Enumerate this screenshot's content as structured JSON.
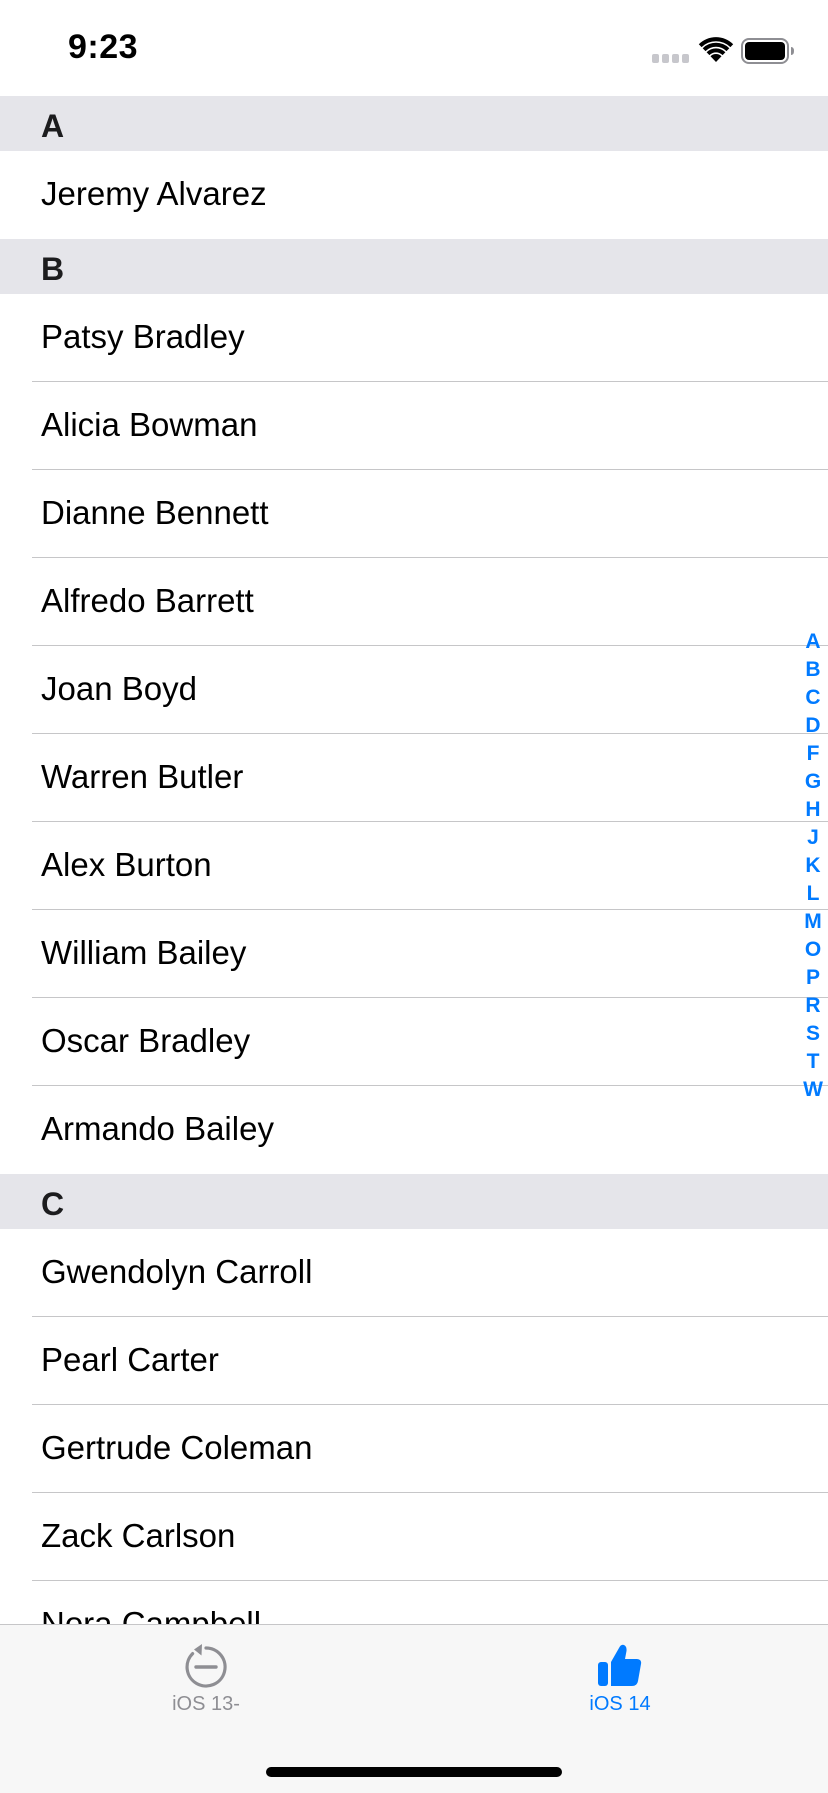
{
  "status_bar": {
    "time": "9:23"
  },
  "sections": [
    {
      "letter": "A",
      "rows": [
        "Jeremy Alvarez"
      ]
    },
    {
      "letter": "B",
      "rows": [
        "Patsy Bradley",
        "Alicia Bowman",
        "Dianne Bennett",
        "Alfredo Barrett",
        "Joan Boyd",
        "Warren Butler",
        "Alex Burton",
        "William Bailey",
        "Oscar Bradley",
        "Armando Bailey"
      ]
    },
    {
      "letter": "C",
      "rows": [
        "Gwendolyn Carroll",
        "Pearl Carter",
        "Gertrude Coleman",
        "Zack Carlson",
        "Nora Campbell"
      ]
    }
  ],
  "section_index": [
    "A",
    "B",
    "C",
    "D",
    "F",
    "G",
    "H",
    "J",
    "K",
    "L",
    "M",
    "O",
    "P",
    "R",
    "S",
    "T",
    "W"
  ],
  "tab_bar": {
    "tabs": [
      {
        "label": "iOS 13-",
        "icon": "rewind-circle-icon",
        "selected": false
      },
      {
        "label": "iOS 14",
        "icon": "thumbs-up-icon",
        "selected": true
      }
    ]
  },
  "colors": {
    "accent": "#007aff",
    "section_header_bg": "#e5e5ea",
    "separator": "#c6c6c8",
    "tab_inactive": "#8e8e93",
    "tab_bar_bg": "#f7f7f7"
  }
}
